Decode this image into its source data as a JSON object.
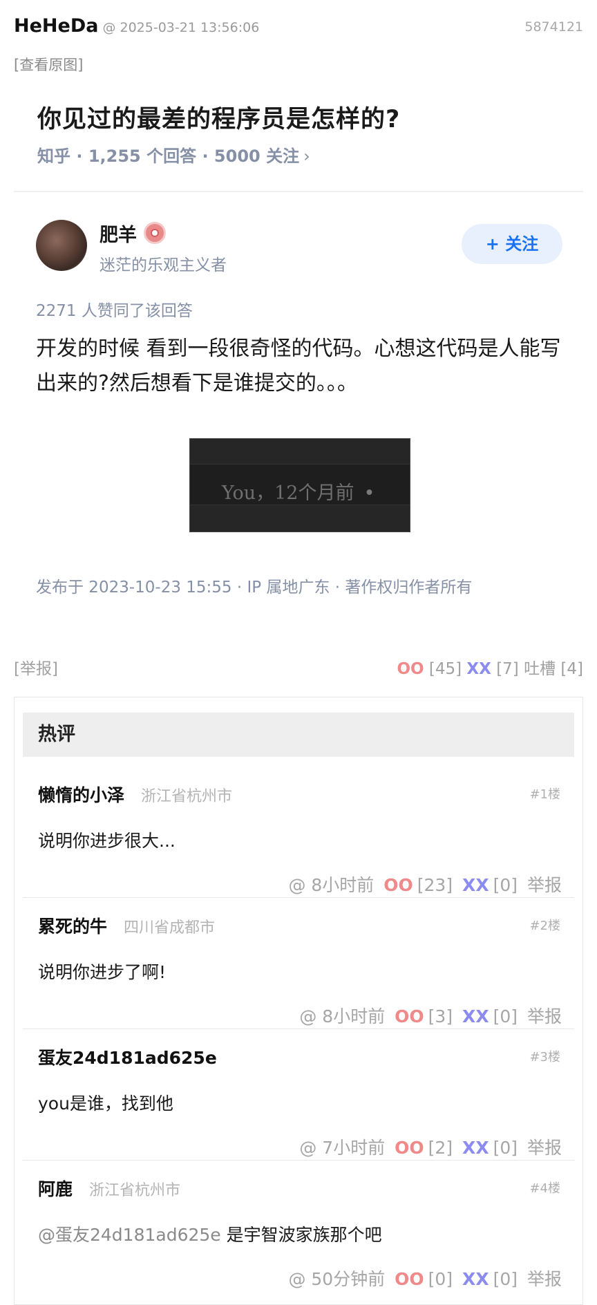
{
  "post": {
    "author": "HeHeDa",
    "time": "@ 2025-03-21 13:56:06",
    "id": "5874121",
    "view_original": "[查看原图]"
  },
  "zhihu": {
    "question_title": "你见过的最差的程序员是怎样的?",
    "question_meta": "知乎 · 1,255 个回答 · 5000 关注",
    "meta_chevron": "›",
    "answerer_name": "肥羊",
    "answerer_bio": "迷茫的乐观主义者",
    "follow_label": "+ 关注",
    "agree_count": "2271 人赞同了该回答",
    "answer_text": "开发的时候 看到一段很奇怪的代码。心想这代码是人能写出来的?然后想看下是谁提交的。。。",
    "blame_text": "You，12个月前",
    "blame_dot": "•",
    "published": "发布于 2023-10-23 15:55 · IP 属地广东 · 著作权归作者所有"
  },
  "actions": {
    "report": "[举报]",
    "oo_label": "OO",
    "oo_count": "[45]",
    "xx_label": "XX",
    "xx_count": "[7]",
    "tucao": "吐槽 [4]"
  },
  "hot": {
    "title": "热评",
    "comments": [
      {
        "name": "懒惰的小泽",
        "location": "浙江省杭州市",
        "floor": "#1楼",
        "text": "说明你进步很大...",
        "mention": "",
        "time": "@ 8小时前",
        "oo": "OO",
        "oo_count": "[23]",
        "xx": "XX",
        "xx_count": "[0]",
        "report": "举报"
      },
      {
        "name": "累死的牛",
        "location": "四川省成都市",
        "floor": "#2楼",
        "text": "说明你进步了啊!",
        "mention": "",
        "time": "@ 8小时前",
        "oo": "OO",
        "oo_count": "[3]",
        "xx": "XX",
        "xx_count": "[0]",
        "report": "举报"
      },
      {
        "name": "蛋友24d181ad625e",
        "location": "",
        "floor": "#3楼",
        "text": "you是谁，找到他",
        "mention": "",
        "time": "@ 7小时前",
        "oo": "OO",
        "oo_count": "[2]",
        "xx": "XX",
        "xx_count": "[0]",
        "report": "举报"
      },
      {
        "name": "阿鹿",
        "location": "浙江省杭州市",
        "floor": "#4楼",
        "text": "是宇智波家族那个吧",
        "mention": "@蛋友24d181ad625e",
        "time": "@ 50分钟前",
        "oo": "OO",
        "oo_count": "[0]",
        "xx": "XX",
        "xx_count": "[0]",
        "report": "举报"
      }
    ]
  }
}
